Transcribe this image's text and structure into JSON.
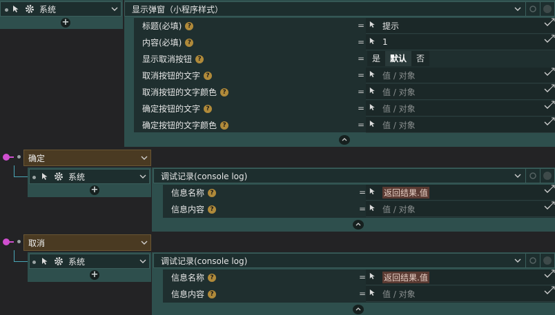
{
  "top": {
    "system_label": "系统",
    "action_title": "显示弹窗（小程序样式）",
    "params": [
      {
        "label": "标题(必填)",
        "value": "提示",
        "kind": "value"
      },
      {
        "label": "内容(必填)",
        "value": "1",
        "kind": "value"
      },
      {
        "label": "显示取消按钮",
        "kind": "segmented",
        "options": [
          "是",
          "默认",
          "否"
        ],
        "selected": "默认"
      },
      {
        "label": "取消按钮的文字",
        "value": "值 / 对象",
        "kind": "placeholder"
      },
      {
        "label": "取消按钮的文字颜色",
        "value": "值 / 对象",
        "kind": "placeholder"
      },
      {
        "label": "确定按钮的文字",
        "value": "值 / 对象",
        "kind": "placeholder"
      },
      {
        "label": "确定按钮的文字颜色",
        "value": "值 / 对象",
        "kind": "placeholder"
      }
    ]
  },
  "eq_sign": "=",
  "help_mark": "?",
  "branches": [
    {
      "label": "确定",
      "system_label": "系统",
      "action_title": "调试记录(console log)",
      "params": [
        {
          "label": "信息名称",
          "value": "返回结果.值",
          "kind": "highlight"
        },
        {
          "label": "信息内容",
          "value": "值 / 对象",
          "kind": "placeholder"
        }
      ]
    },
    {
      "label": "取消",
      "system_label": "系统",
      "action_title": "调试记录(console log)",
      "params": [
        {
          "label": "信息名称",
          "value": "返回结果.值",
          "kind": "highlight"
        },
        {
          "label": "信息内容",
          "value": "值 / 对象",
          "kind": "placeholder"
        }
      ]
    }
  ]
}
